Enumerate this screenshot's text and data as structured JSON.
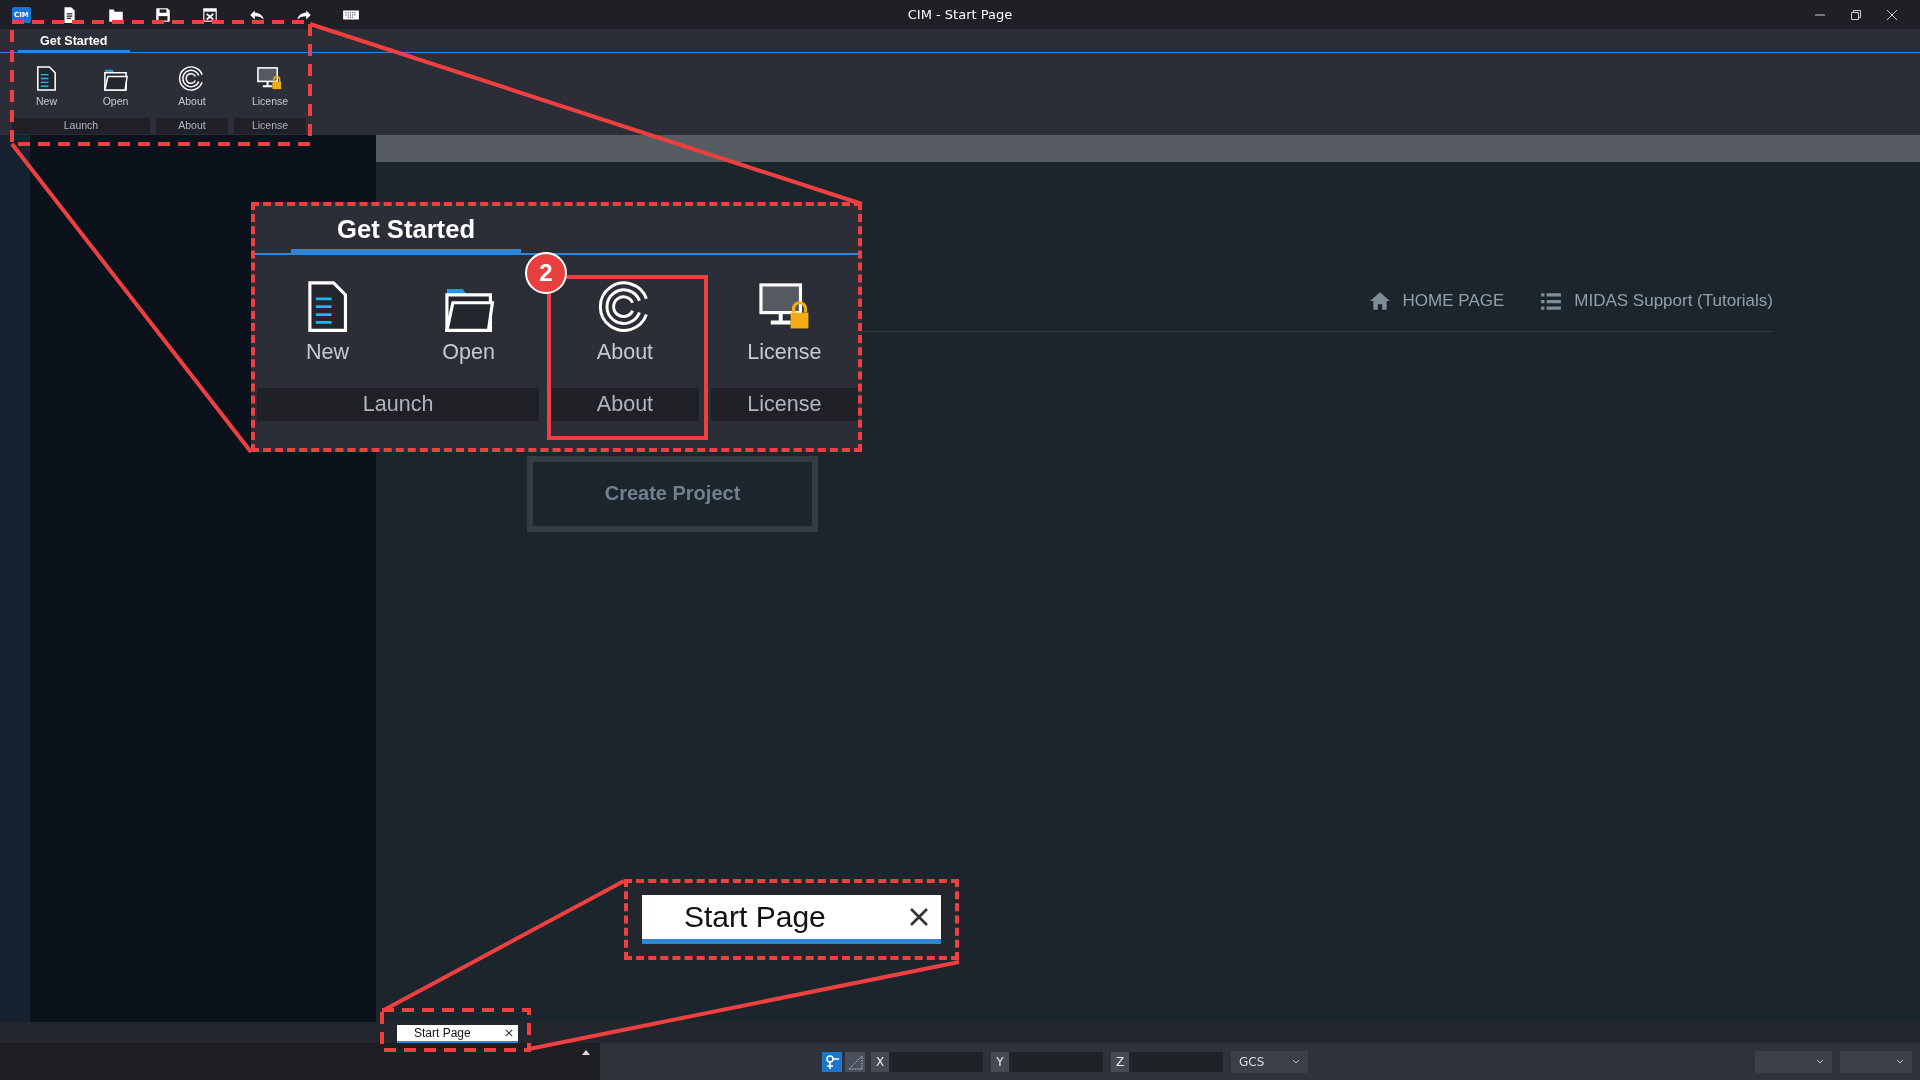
{
  "title_bar": {
    "logo": "CIM",
    "title": "CIM - Start Page"
  },
  "ribbon": {
    "tabs": [
      {
        "label": "Get Started",
        "selected": true
      }
    ],
    "groups": [
      {
        "name": "Launch",
        "buttons": [
          "New",
          "Open"
        ]
      },
      {
        "name": "About",
        "buttons": [
          "About"
        ]
      },
      {
        "name": "License",
        "buttons": [
          "License"
        ]
      }
    ]
  },
  "start_page": {
    "links": [
      "HOME PAGE",
      "MIDAS Support (Tutorials)"
    ],
    "create_button": "Create Project"
  },
  "document_tabs": [
    {
      "label": "Start Page",
      "selected": true
    }
  ],
  "status_bar": {
    "coordinate_fields": [
      "X",
      "Y",
      "Z"
    ],
    "coordinate_system": "GCS"
  },
  "annotations": {
    "badge": "2",
    "zoomed_ribbon": {
      "tabs": [
        {
          "label": "Get Started",
          "selected": true
        }
      ],
      "groups": [
        {
          "name": "Launch",
          "buttons": [
            "New",
            "Open"
          ]
        },
        {
          "name": "About",
          "buttons": [
            "About"
          ]
        },
        {
          "name": "License",
          "buttons": [
            "License"
          ]
        }
      ]
    },
    "zoomed_tab": {
      "label": "Start Page"
    }
  }
}
